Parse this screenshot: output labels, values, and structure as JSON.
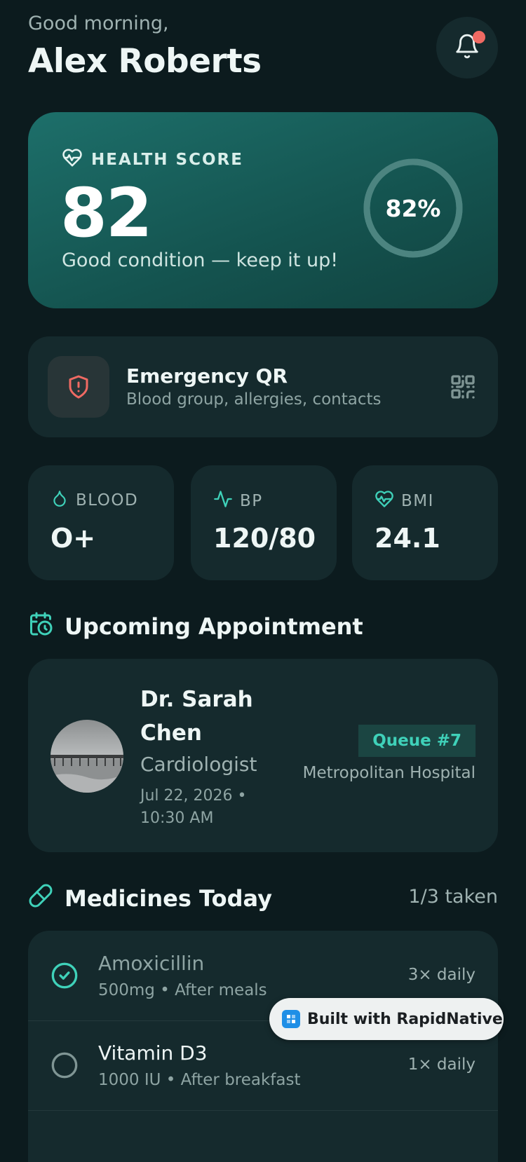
{
  "header": {
    "greeting": "Good morning,",
    "user_name": "Alex Roberts"
  },
  "health_score": {
    "label": "HEALTH SCORE",
    "value": "82",
    "subtitle": "Good condition — keep it up!",
    "percent_text": "82%",
    "progress": 0.82
  },
  "emergency_qr": {
    "title": "Emergency QR",
    "subtitle": "Blood group, allergies, contacts"
  },
  "stats": [
    {
      "label": "BLOOD",
      "value": "O+",
      "icon": "droplet-icon"
    },
    {
      "label": "BP",
      "value": "120/80",
      "icon": "pulse-icon"
    },
    {
      "label": "BMI",
      "value": "24.1",
      "icon": "heart-pulse-icon"
    }
  ],
  "appointment": {
    "section_title": "Upcoming Appointment",
    "doctor_name": "Dr. Sarah Chen",
    "specialty": "Cardiologist",
    "datetime": "Jul 22, 2026 • 10:30 AM",
    "queue": "Queue #7",
    "hospital": "Metropolitan Hospital"
  },
  "medicines": {
    "section_title": "Medicines Today",
    "count_text": "1/3 taken",
    "items": [
      {
        "name": "Amoxicillin",
        "detail": "500mg • After meals",
        "frequency": "3× daily",
        "taken": true
      },
      {
        "name": "Vitamin D3",
        "detail": "1000 IU • After breakfast",
        "frequency": "1× daily",
        "taken": false
      }
    ]
  },
  "badge": {
    "label": "Built with RapidNative"
  },
  "colors": {
    "background": "#0c1b1e",
    "card": "#152a2d",
    "accent": "#3fd1b9",
    "alert": "#f06a63"
  }
}
